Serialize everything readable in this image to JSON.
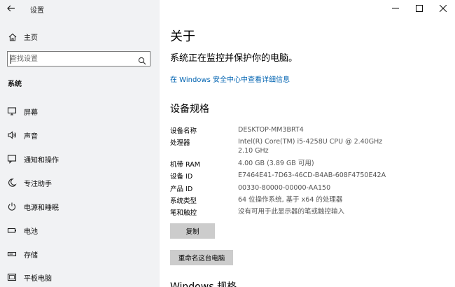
{
  "window": {
    "title": "设置"
  },
  "sidebar": {
    "home_label": "主页",
    "search_placeholder": "查找设置",
    "section_label": "系统",
    "items": [
      {
        "label": "屏幕",
        "icon": "monitor-icon"
      },
      {
        "label": "声音",
        "icon": "speaker-icon"
      },
      {
        "label": "通知和操作",
        "icon": "notification-icon"
      },
      {
        "label": "专注助手",
        "icon": "moon-icon"
      },
      {
        "label": "电源和睡眠",
        "icon": "power-icon"
      },
      {
        "label": "电池",
        "icon": "battery-icon"
      },
      {
        "label": "存储",
        "icon": "storage-icon"
      },
      {
        "label": "平板电脑",
        "icon": "tablet-icon"
      }
    ]
  },
  "main": {
    "title": "关于",
    "subtitle": "系统正在监控并保护你的电脑。",
    "security_link": "在 Windows 安全中心中查看详细信息",
    "specs_title": "设备规格",
    "specs": [
      {
        "key": "设备名称",
        "value": "DESKTOP-MM3BRT4"
      },
      {
        "key": "处理器",
        "value": "Intel(R) Core(TM) i5-4258U CPU @ 2.40GHz   2.10 GHz"
      },
      {
        "key": "机带 RAM",
        "value": "4.00 GB (3.89 GB 可用)"
      },
      {
        "key": "设备 ID",
        "value": "E7464E41-7D63-46CD-B4AB-608F4750E42A"
      },
      {
        "key": "产品 ID",
        "value": "00330-80000-00000-AA150"
      },
      {
        "key": "系统类型",
        "value": "64 位操作系统, 基于 x64 的处理器"
      },
      {
        "key": "笔和触控",
        "value": "没有可用于此显示器的笔或触控输入"
      }
    ],
    "copy_button": "复制",
    "rename_button": "重命名这台电脑",
    "next_section_title": "Windows 规格"
  }
}
